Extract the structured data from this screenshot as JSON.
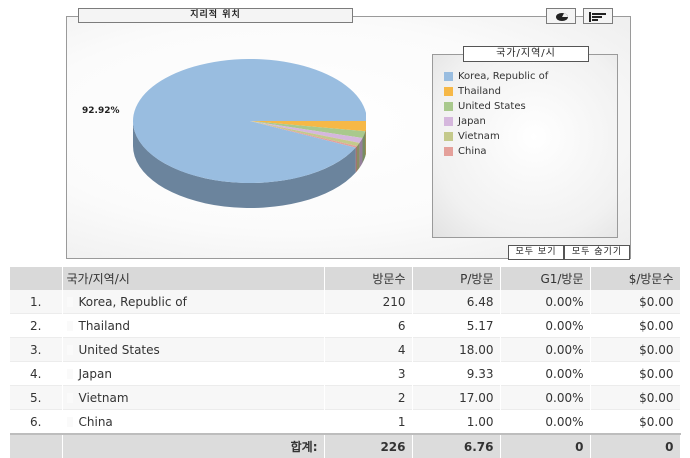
{
  "chart_panel": {
    "title": "지리적 위치",
    "pie_label": "92.92%",
    "buttons": {
      "show_all": "모두 보기",
      "hide_all": "모두 숨기기"
    }
  },
  "legend": {
    "title": "국가/지역/시",
    "items": [
      {
        "label": "Korea, Republic of",
        "color": "#99bde0"
      },
      {
        "label": "Thailand",
        "color": "#f6b847"
      },
      {
        "label": "United States",
        "color": "#a9c98d"
      },
      {
        "label": "Japan",
        "color": "#d5b7dd"
      },
      {
        "label": "Vietnam",
        "color": "#c4c98b"
      },
      {
        "label": "China",
        "color": "#e4a09a"
      }
    ]
  },
  "chart_data": {
    "type": "pie",
    "title": "지리적 위치",
    "categories": [
      "Korea, Republic of",
      "Thailand",
      "United States",
      "Japan",
      "Vietnam",
      "China"
    ],
    "values": [
      210,
      6,
      4,
      3,
      2,
      1
    ],
    "colors": [
      "#99bde0",
      "#f6b847",
      "#a9c98d",
      "#d5b7dd",
      "#c4c98b",
      "#e4a09a"
    ],
    "annotations": [
      "92.92%"
    ],
    "legend_position": "right",
    "style": "3d"
  },
  "table": {
    "headers": {
      "name": "국가/지역/시",
      "visits": "방문수",
      "pages": "P/방문",
      "goal": "G1/방문",
      "value": "$/방문수"
    },
    "rows": [
      {
        "idx": "1.",
        "name": "Korea, Republic of",
        "visits": "210",
        "pages": "6.48",
        "goal": "0.00%",
        "value": "$0.00"
      },
      {
        "idx": "2.",
        "name": "Thailand",
        "visits": "6",
        "pages": "5.17",
        "goal": "0.00%",
        "value": "$0.00"
      },
      {
        "idx": "3.",
        "name": "United States",
        "visits": "4",
        "pages": "18.00",
        "goal": "0.00%",
        "value": "$0.00"
      },
      {
        "idx": "4.",
        "name": "Japan",
        "visits": "3",
        "pages": "9.33",
        "goal": "0.00%",
        "value": "$0.00"
      },
      {
        "idx": "5.",
        "name": "Vietnam",
        "visits": "2",
        "pages": "17.00",
        "goal": "0.00%",
        "value": "$0.00"
      },
      {
        "idx": "6.",
        "name": "China",
        "visits": "1",
        "pages": "1.00",
        "goal": "0.00%",
        "value": "$0.00"
      }
    ],
    "totals": {
      "label": "합계:",
      "visits": "226",
      "pages": "6.76",
      "goal": "0",
      "value": "0"
    }
  }
}
